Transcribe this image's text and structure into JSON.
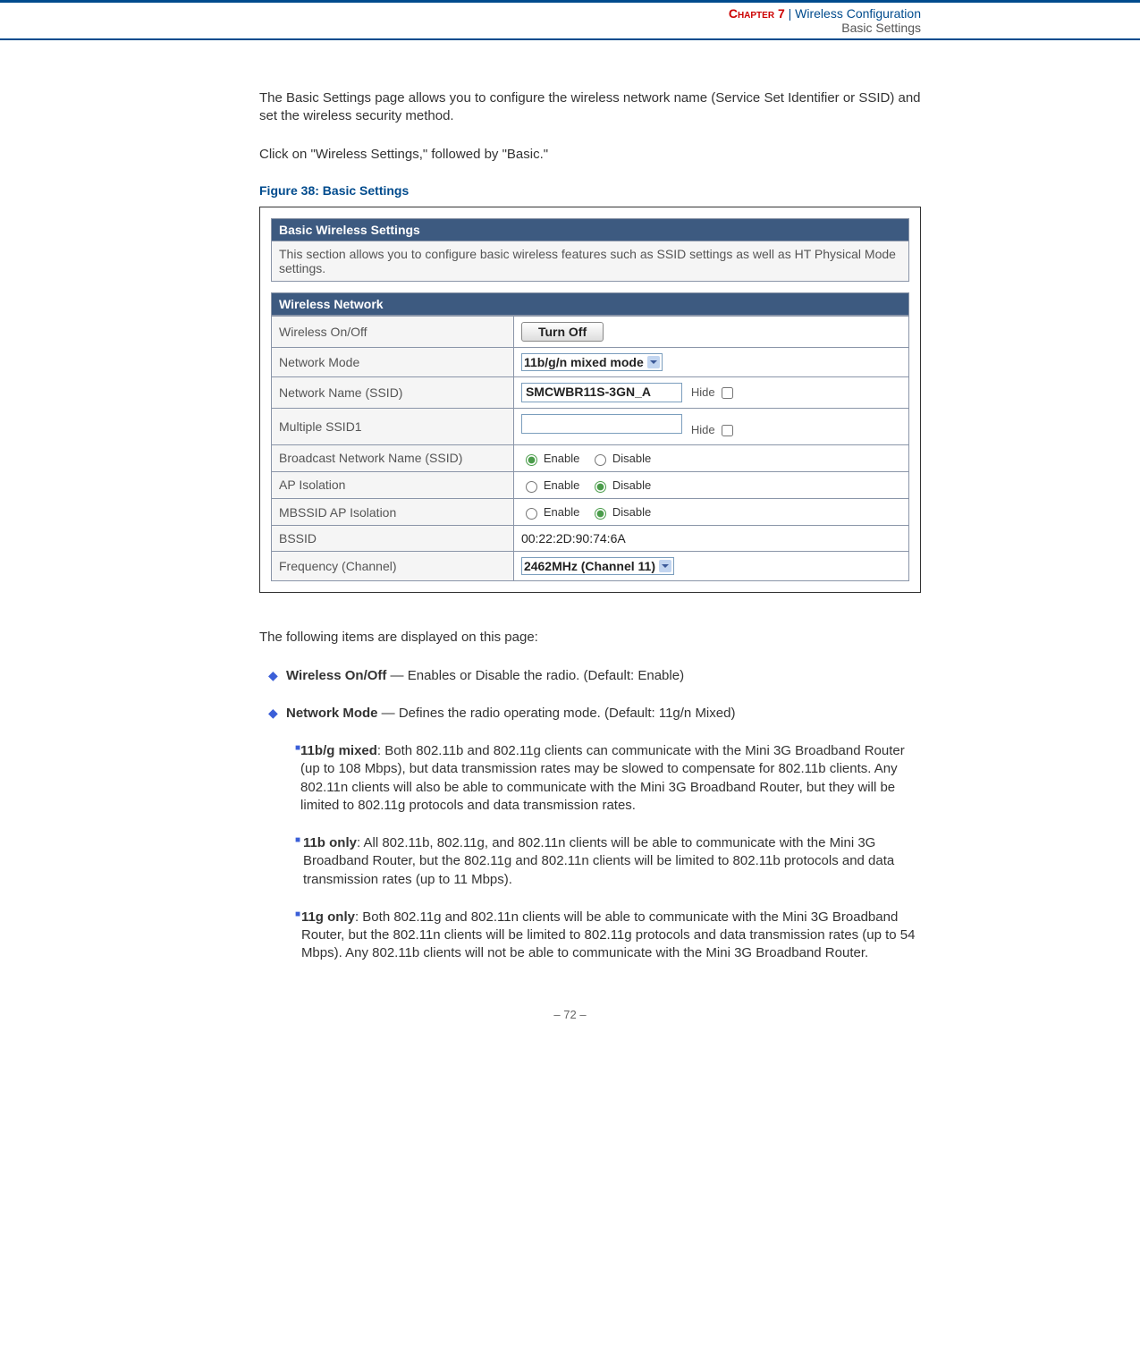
{
  "header": {
    "chapter_label": "Chapter 7",
    "separator": "|",
    "section": "Wireless Configuration",
    "subsection": "Basic Settings"
  },
  "intro": {
    "para1": "The Basic Settings page allows you to configure the wireless network name (Service Set Identifier or SSID) and set the wireless security method.",
    "para2": "Click on \"Wireless Settings,\" followed by \"Basic.\"",
    "figure_caption": "Figure 38:  Basic Settings"
  },
  "screenshot": {
    "panel1_title": "Basic Wireless Settings",
    "panel1_desc": "This section allows you to configure basic wireless features such as SSID settings as well as HT Physical Mode settings.",
    "panel2_title": "Wireless Network",
    "rows": {
      "wireless_onoff_label": "Wireless On/Off",
      "wireless_onoff_button": "Turn Off",
      "network_mode_label": "Network Mode",
      "network_mode_value": "11b/g/n mixed mode",
      "network_name_label": "Network Name (SSID)",
      "network_name_value": "SMCWBR11S-3GN_A",
      "hide_label": "Hide",
      "multiple_ssid_label": "Multiple SSID1",
      "multiple_ssid_value": "",
      "broadcast_label": "Broadcast Network Name (SSID)",
      "enable_label": "Enable",
      "disable_label": "Disable",
      "ap_isolation_label": "AP Isolation",
      "mbssid_label": "MBSSID AP Isolation",
      "bssid_label": "BSSID",
      "bssid_value": "00:22:2D:90:74:6A",
      "freq_label": "Frequency (Channel)",
      "freq_value": "2462MHz (Channel 11)"
    }
  },
  "description": {
    "intro": "The following items are displayed on this page:",
    "items": [
      {
        "term": "Wireless On/Off",
        "desc": " — Enables or Disable the radio. (Default: Enable)"
      },
      {
        "term": "Network Mode",
        "desc": " — Defines the radio operating mode. (Default: 11g/n Mixed)"
      }
    ],
    "subitems": [
      {
        "term": "11b/g mixed",
        "desc": ": Both 802.11b and 802.11g clients can communicate with the Mini 3G Broadband Router (up to 108 Mbps), but data transmission rates may be slowed to compensate for 802.11b clients. Any 802.11n clients will also be able to communicate with the Mini 3G Broadband Router, but they will be limited to 802.11g protocols and data transmission rates."
      },
      {
        "term": "11b only",
        "desc": ": All 802.11b, 802.11g, and 802.11n clients will be able to communicate with the Mini 3G Broadband Router, but the 802.11g and 802.11n clients will be limited to 802.11b protocols and data transmission rates (up to 11 Mbps)."
      },
      {
        "term": "11g only",
        "desc": ": Both 802.11g and 802.11n clients will be able to communicate with the Mini 3G Broadband Router, but the 802.11n clients will be limited to 802.11g protocols and data transmission rates (up to 54 Mbps). Any 802.11b clients will not be able to communicate with the Mini 3G Broadband Router."
      }
    ]
  },
  "footer": {
    "page": "–  72  –"
  }
}
